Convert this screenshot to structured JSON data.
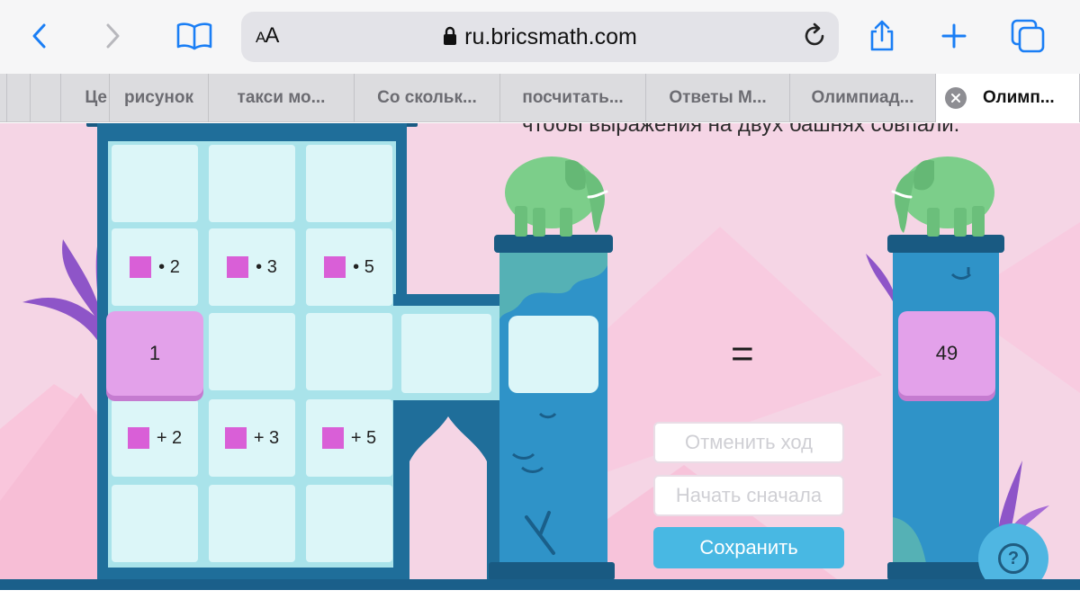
{
  "browser": {
    "text_size_label": "AA",
    "url": "ru.bricsmath.com"
  },
  "tabs": [
    {
      "label": "Це"
    },
    {
      "label": "рисунок"
    },
    {
      "label": "такси мо..."
    },
    {
      "label": "Со скольк..."
    },
    {
      "label": "посчитать..."
    },
    {
      "label": "Ответы М..."
    },
    {
      "label": "Олимпиад..."
    },
    {
      "label": "Олимп...",
      "active": true
    }
  ],
  "game": {
    "task_text": "чтобы выражения на двух башнях совпали.",
    "start_value": "1",
    "operations": {
      "multiply": [
        "• 2",
        "• 3",
        "• 5"
      ],
      "add": [
        "+ 2",
        "+ 3",
        "+ 5"
      ]
    },
    "equals_sign": "=",
    "target_value": "49",
    "buttons": {
      "undo": "Отменить ход",
      "restart": "Начать сначала",
      "save": "Сохранить"
    },
    "help_label": "?"
  },
  "colors": {
    "background": "#f5d5e5",
    "tower_dark": "#1f6e9a",
    "tower_column": "#2f93c8",
    "cell": "#dcf6f8",
    "number_tile": "#e3a1ea",
    "square_marker": "#d95fd7",
    "save_button": "#48b8e3",
    "elephant": "#7cce8a"
  },
  "icons": [
    "back-icon",
    "forward-icon",
    "bookmarks-icon",
    "lock-icon",
    "reload-icon",
    "share-icon",
    "new-tab-icon",
    "tabs-overview-icon",
    "close-tab-icon",
    "help-icon"
  ]
}
